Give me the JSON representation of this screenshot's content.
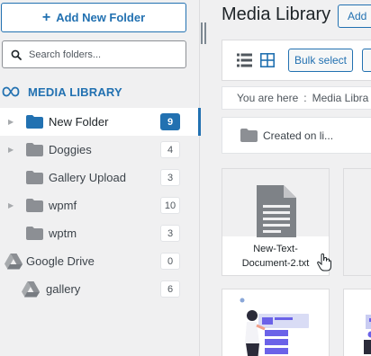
{
  "sidebar": {
    "add_folder_label": "Add New Folder",
    "search_placeholder": "Search folders...",
    "library_label": "MEDIA LIBRARY",
    "folders": [
      {
        "name": "New Folder",
        "count": "9",
        "active": true,
        "has_children": true
      },
      {
        "name": "Doggies",
        "count": "4",
        "active": false,
        "has_children": true
      },
      {
        "name": "Gallery Upload",
        "count": "3",
        "active": false,
        "has_children": false
      },
      {
        "name": "wpmf",
        "count": "10",
        "active": false,
        "has_children": true
      },
      {
        "name": "wptm",
        "count": "3",
        "active": false,
        "has_children": false
      }
    ],
    "drive": {
      "name": "Google Drive",
      "count": "0"
    },
    "drive_sub": {
      "name": "gallery",
      "count": "6"
    }
  },
  "main": {
    "title": "Media Library",
    "add_label": "Add",
    "bulk_select_label": "Bulk select",
    "breadcrumb": {
      "prefix": "You are here",
      "separator": ":",
      "current": "Media Libra"
    },
    "sort_label": "Created on li...",
    "file_name": "New-Text-Document-2.txt"
  },
  "colors": {
    "accent": "#2271b1",
    "folder_active": "#2271b1",
    "folder": "#8c8f94",
    "background": "#f0f0f1"
  }
}
